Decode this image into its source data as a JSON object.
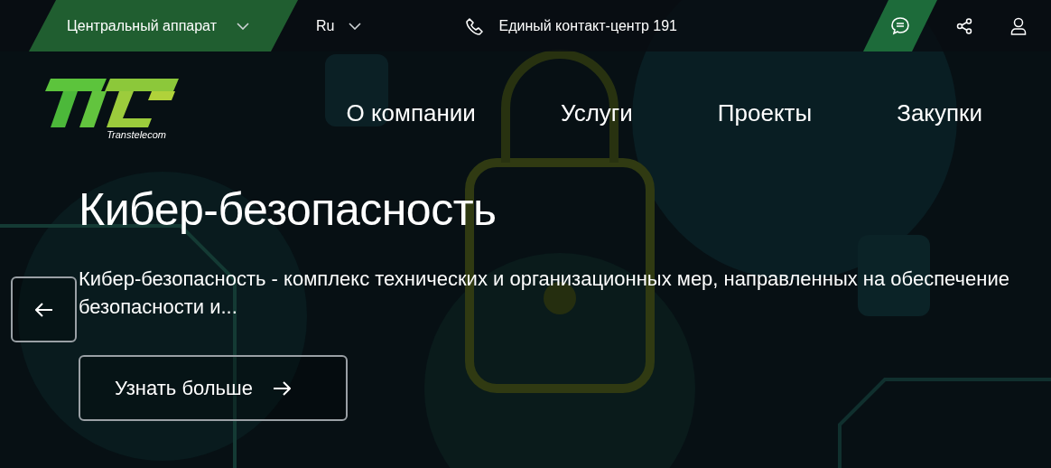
{
  "top_bar": {
    "region": {
      "label": "Центральный аппарат"
    },
    "language": {
      "label": "Ru"
    },
    "contact": {
      "label": "Единый контакт-центр 191"
    }
  },
  "logo": {
    "caption": "Transtelecom"
  },
  "nav": [
    {
      "label": "О компании"
    },
    {
      "label": "Услуги"
    },
    {
      "label": "Проекты"
    },
    {
      "label": "Закупки"
    }
  ],
  "hero": {
    "title": "Кибер-безопасность",
    "description": "Кибер-безопасность - комплекс технических и организационных мер, направленных на обеспечение безопасности и...",
    "button": "Узнать больше"
  }
}
